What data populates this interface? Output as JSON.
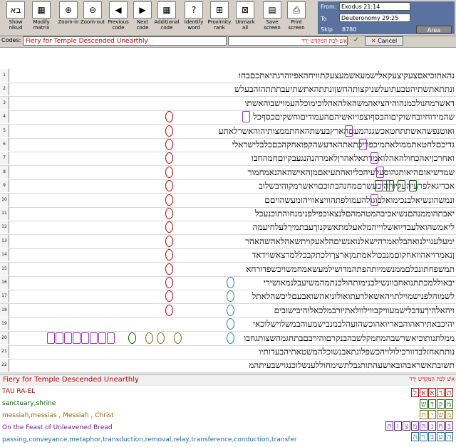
{
  "toolbar": {
    "buttons": [
      {
        "label": "Show\nnikud",
        "icon": "בא",
        "icon_name": "nikud-icon"
      },
      {
        "label": "Modify\nmatrix",
        "icon": "▦",
        "icon_name": "matrix-icon"
      },
      {
        "label": "Zoom-in",
        "icon": "⊕",
        "icon_name": "zoom-in-icon"
      },
      {
        "label": "Zoom-out",
        "icon": "⊖",
        "icon_name": "zoom-out-icon"
      },
      {
        "label": "Previous\ncode",
        "icon": "◀",
        "icon_name": "previous-code-icon"
      },
      {
        "label": "Next\ncode",
        "icon": "▶",
        "icon_name": "next-code-icon"
      },
      {
        "label": "Additional\ncode",
        "icon": "▦",
        "icon_name": "additional-code-icon"
      },
      {
        "label": "Identify\nword",
        "icon": "?",
        "icon_name": "identify-word-icon"
      },
      {
        "label": "Proximity\nrank",
        "icon": "⊞",
        "icon_name": "proximity-rank-icon"
      },
      {
        "label": "Unmark\nall",
        "icon": "⊠",
        "icon_name": "unmark-all-icon"
      },
      {
        "label": "Save\nscreen",
        "icon": "▤",
        "icon_name": "save-screen-icon"
      },
      {
        "label": "Print\nscreen",
        "icon": "⎙",
        "icon_name": "print-screen-icon"
      }
    ]
  },
  "range": {
    "from_label": "From:",
    "from_value": "Exodus 21:14",
    "to_label": "To",
    "to_value": "Deuteronomy 29:25",
    "skip_label": "Skip",
    "skip_value": "8780",
    "area_label": "Area"
  },
  "codes": {
    "label": "Codes:",
    "value": "Fiery for Temple Descended Unearthly",
    "sequence": "אשׁ לִבַּת הַמִּקְדָּשׁ יָרַד",
    "cancel_label": "Cancel",
    "ok_icon": "✓"
  },
  "grid": {
    "rows": [
      {
        "n": "1",
        "t": "נהאתוכיאםצעקיצעקאלישמעאשמעצעקתוויחהאפיוהרגתיאתכםבחו"
      },
      {
        "n": "2",
        "t": "ונתתאתשתיהטבעתועלשניקצותהחשןונתתהאתשתיעבתתתהזהבעלש"
      },
      {
        "n": "3",
        "t": "דאשרמחנולכמנהוהיהציאהמשהאלהאהלוכימוכלהעמוישבוהאשתו"
      },
      {
        "n": "4",
        "t": "שהמידוחיובחשוקיםוהכסףוצפויואשיהםהעמודיםוחשקיםכסףכל"
      },
      {
        "n": "5",
        "t": "ואוטנפשהאשתתחטאכשגגהמעםהארץבעשתהאחתממצותיהוהאשרלאתע"
      },
      {
        "n": "6",
        "t": "גדיכםלחטאתממולאתמיכפריכתאתהאדעשהקפואחקהכםכלבלישראלי"
      },
      {
        "n": "7",
        "t": "ואחרכןיאהכחולהאהלואמרתאלאהרןלאמרהנהנגעבקיוםחמהחבו"
      },
      {
        "n": "8",
        "t": "שמדשיאוםהיאותגהוסעלעיהכליואהתעיאםמןהאישהאהנאמחמור"
      },
      {
        "n": "9",
        "t": "אכדיגאלפרעיהעליוויהיכעשרםמחנהבתוכםויאשרמקוהיבשלוב"
      },
      {
        "n": "10",
        "t": "ונמשהונשיאלבנכימואלבוגולהעמולפתהוויצאוויהומעשהויםם"
      },
      {
        "n": "11",
        "t": "יאבתהוממנהםנשיאכיבהמטהמהםלנצאוכפילפנימנחוהתוכנעכל"
      },
      {
        "n": "12",
        "t": "ליאמשהואלעבדיואשלוייהמלאעלמתאשקנוךעבתמיךלעלחיעמה"
      },
      {
        "n": "13",
        "t": "ימעלעגוילנואהבלואמרהישאלנואנשיםהלאעקויתשאהלאהשהאהר"
      },
      {
        "n": "14",
        "t": "ןנאמרויאהוואחקוםמנבכולאמתמןארצךולכתקבכללמרצאשוידאד"
      },
      {
        "n": "15",
        "t": "תמשפחתונכלםממנשמיותהפתהמדושילמעשאמחמשויכשפדורחא"
      },
      {
        "n": "16",
        "t": "יבאוללמכתתנואחבוונשילבנימותהולכנתמהמשיעבלנמאושירי"
      },
      {
        "n": "17",
        "t": "לשמוהלפנישמוילתויהאשאלרעתואולוניאהשואבעםליכשהלאתל"
      },
      {
        "n": "18",
        "t": "ויהאלהיךעדבלישמעוויקבווילוולאתיורבמלכאלוהיבישובים"
      },
      {
        "n": "19",
        "t": "יהיכבאתיראהוהבאריואהוכשהועהלבמנבישמעוהבמשלוישלוכאי"
      },
      {
        "n": "20",
        "t": "ממלתנותוכיאשרשבהמחמקלשבהבנקרםוהירבםבתחגמהשצותגחבו"
      },
      {
        "n": "21",
        "t": "נותתאחזלבדוורכילולויהכשפלונתאבנשוכלהמשטאתיהבעדותיו"
      },
      {
        "n": "22",
        "t": "תשובתאשראבהובאושעהתותגבלתשימחוללענשלוכנגוישבעיתהמ"
      }
    ]
  },
  "bottom": {
    "code_title": "Fiery for Temple Descended Unearthly",
    "sequence": "אשׁ לִבַּת הַמִּקְדָּשׁ יָרַד"
  },
  "definitions": [
    {
      "text": "TAU RA-EL",
      "color": "#c00000"
    },
    {
      "text": "sanctuary,shrine",
      "color": "#006000"
    },
    {
      "text": "messiah,messias , Messiah , Christ",
      "color": "#8a6a00"
    },
    {
      "text": "On the Feast of Unleavened Bread",
      "color": "#6a1aa0"
    },
    {
      "text": "passing,conveyance,metaphor,transduction,removal,relay,transference,conduction,transfer",
      "color": "#1a6a9a"
    }
  ],
  "legend": [
    {
      "word": "תראאל",
      "color": "#c00000"
    },
    {
      "word": "מקדש",
      "color": "#006000"
    },
    {
      "word": "משיח",
      "color": "#8a6a00"
    },
    {
      "word": "בחגהמצות",
      "color": "#6a1aa0"
    },
    {
      "word": "העברה",
      "color": "#1a6a9a"
    }
  ],
  "colors": {
    "red": "#c00000",
    "green": "#006000",
    "purple": "#a030c0",
    "teal": "#1a8a9a",
    "header_blue": "#5a72a0"
  }
}
